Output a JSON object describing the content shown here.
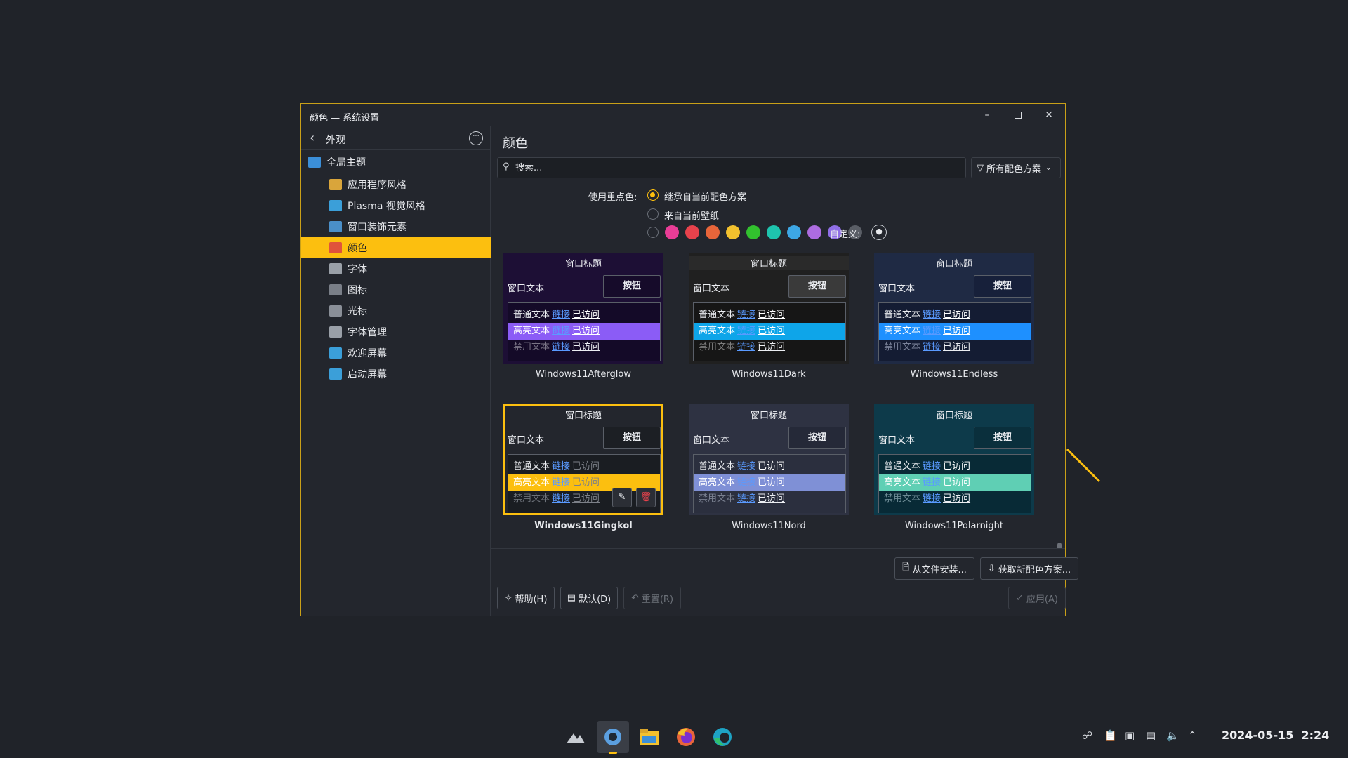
{
  "window": {
    "title": "颜色 — 系统设置",
    "minimize_icon": "minimize-icon",
    "maximize_icon": "maximize-icon",
    "close_icon": "close-icon"
  },
  "sidebar": {
    "back_label": "外观",
    "items": [
      {
        "label": "全局主题",
        "icon": "global-theme-icon",
        "color": "#3b8fd9",
        "active": false
      },
      {
        "label": "应用程序风格",
        "icon": "app-style-icon",
        "color": "#d9a53b",
        "active": false
      },
      {
        "label": "Plasma 视觉风格",
        "icon": "plasma-style-icon",
        "color": "#3b9fd9",
        "active": false
      },
      {
        "label": "窗口装饰元素",
        "icon": "window-decoration-icon",
        "color": "#4a8fc9",
        "active": false
      },
      {
        "label": "颜色",
        "icon": "colors-icon",
        "color": "#e0533b",
        "active": true
      },
      {
        "label": "字体",
        "icon": "fonts-icon",
        "color": "#9aa0a8",
        "active": false
      },
      {
        "label": "图标",
        "icon": "icons-icon",
        "color": "#7a7f88",
        "active": false
      },
      {
        "label": "光标",
        "icon": "cursor-icon",
        "color": "#8a8f98",
        "active": false
      },
      {
        "label": "字体管理",
        "icon": "font-management-icon",
        "color": "#9aa0a8",
        "active": false
      },
      {
        "label": "欢迎屏幕",
        "icon": "splash-screen-icon",
        "color": "#3b9fd9",
        "active": false
      },
      {
        "label": "启动屏幕",
        "icon": "boot-screen-icon",
        "color": "#3b9fd9",
        "active": false
      }
    ]
  },
  "main": {
    "title": "颜色",
    "search_placeholder": "搜索...",
    "filter_label": "所有配色方案",
    "accent_label": "使用重点色:",
    "accent_options": [
      "继承自当前配色方案",
      "来自当前壁纸"
    ],
    "accent_selected": 0,
    "swatches": [
      "#e93d96",
      "#e8424c",
      "#e8653a",
      "#f2c12e",
      "#32c12e",
      "#1ec4ae",
      "#3da7e5",
      "#ad6ce0",
      "#8f6ee6",
      "#5a5e66"
    ],
    "custom_label": "自定义:"
  },
  "preview_text": {
    "window_title": "窗口标题",
    "window_text": "窗口文本",
    "button": "按钮",
    "normal": "普通文本",
    "highlight": "高亮文本",
    "disabled": "禁用文本",
    "link": "链接",
    "visited": "已访问"
  },
  "schemes": [
    {
      "name": "Windows11Afterglow",
      "selected": false,
      "bg": "#1d0f35",
      "title_bg": "#1d0f35",
      "btn_bg": "#160b2a",
      "view_bg": "#140a28",
      "hl_bg": "#8b5cf6",
      "hl_fg": "#ffffff",
      "fg": "#eceef2",
      "link": "#5a9aff",
      "visited": "#ffffff",
      "dis": "#7a7486"
    },
    {
      "name": "Windows11Dark",
      "selected": false,
      "bg": "#202020",
      "title_bg": "#2a2a2a",
      "btn_bg": "#3a3a3a",
      "view_bg": "#161616",
      "hl_bg": "#0ea5e9",
      "hl_fg": "#ffffff",
      "fg": "#eceef2",
      "link": "#5a9aff",
      "visited": "#ffffff",
      "dis": "#7c7c7c"
    },
    {
      "name": "Windows11Endless",
      "selected": false,
      "bg": "#1f2a44",
      "title_bg": "#1f2a44",
      "btn_bg": "#17203a",
      "view_bg": "#141c33",
      "hl_bg": "#1e90ff",
      "hl_fg": "#ffffff",
      "fg": "#eceef2",
      "link": "#5a9aff",
      "visited": "#ffffff",
      "dis": "#7a8299"
    },
    {
      "name": "Windows11Gingkol",
      "selected": true,
      "bg": "#23262d",
      "title_bg": "#23262d",
      "btn_bg": "#1c1f24",
      "view_bg": "#1a1d22",
      "hl_bg": "#fcbf0f",
      "hl_fg": "#ffffff",
      "fg": "#eceef2",
      "link": "#5a9aff",
      "visited": "#7c8088",
      "dis": "#6d727a"
    },
    {
      "name": "Windows11Nord",
      "selected": false,
      "bg": "#2e3242",
      "title_bg": "#2e3242",
      "btn_bg": "#252938",
      "view_bg": "#2b2f3e",
      "hl_bg": "#7f90d6",
      "hl_fg": "#ffffff",
      "fg": "#eceef2",
      "link": "#5a9aff",
      "visited": "#ffffff",
      "dis": "#7a8090"
    },
    {
      "name": "Windows11Polarnight",
      "selected": false,
      "bg": "#0d3a4a",
      "title_bg": "#0d3a4a",
      "btn_bg": "#0a2f3c",
      "view_bg": "#082a36",
      "hl_bg": "#5fcfb4",
      "hl_fg": "#ffffff",
      "fg": "#eceef2",
      "link": "#5a9aff",
      "visited": "#ffffff",
      "dis": "#6c8a94"
    }
  ],
  "footer": {
    "install_from_file": "从文件安装...",
    "get_new": "获取新配色方案...",
    "help": "帮助(H)",
    "defaults": "默认(D)",
    "reset": "重置(R)",
    "apply": "应用(A)"
  },
  "taskbar": {
    "apps": [
      "kde-menu-icon",
      "system-settings-icon",
      "file-manager-icon",
      "firefox-icon",
      "edge-icon"
    ],
    "tray_icons": [
      "update-icon",
      "clipboard-icon",
      "display-icon",
      "network-icon",
      "volume-icon",
      "expand-tray-icon"
    ],
    "date": "2024-05-15",
    "time": "2:24"
  }
}
